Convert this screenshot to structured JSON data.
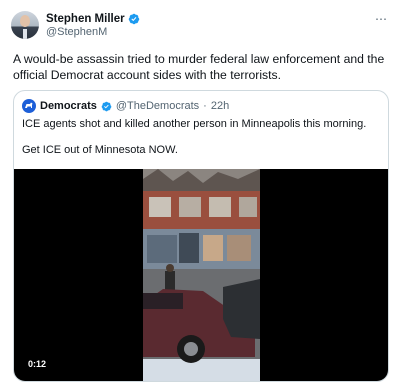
{
  "author": {
    "name": "Stephen Miller",
    "handle": "@StephenM",
    "verified": true
  },
  "more_icon": "⋯",
  "tweet_text": "A would-be assassin tried to murder federal law enforcement and the official Democrat account sides with the terrorists.",
  "quoted": {
    "name": "Democrats",
    "handle": "@TheDemocrats",
    "separator": "·",
    "time": "22h",
    "lines": [
      "ICE agents shot and killed another person in Minneapolis this morning.",
      "Get ICE out of Minnesota NOW."
    ],
    "video": {
      "duration": "0:12"
    }
  },
  "colors": {
    "verified_blue": "#1d9bf0",
    "democrats_blue": "#1d5fd8",
    "secondary_text": "#536471",
    "border": "#cfd9de"
  },
  "icons": [
    "verified-badge-icon",
    "more-icon",
    "democrats-logo-icon"
  ]
}
